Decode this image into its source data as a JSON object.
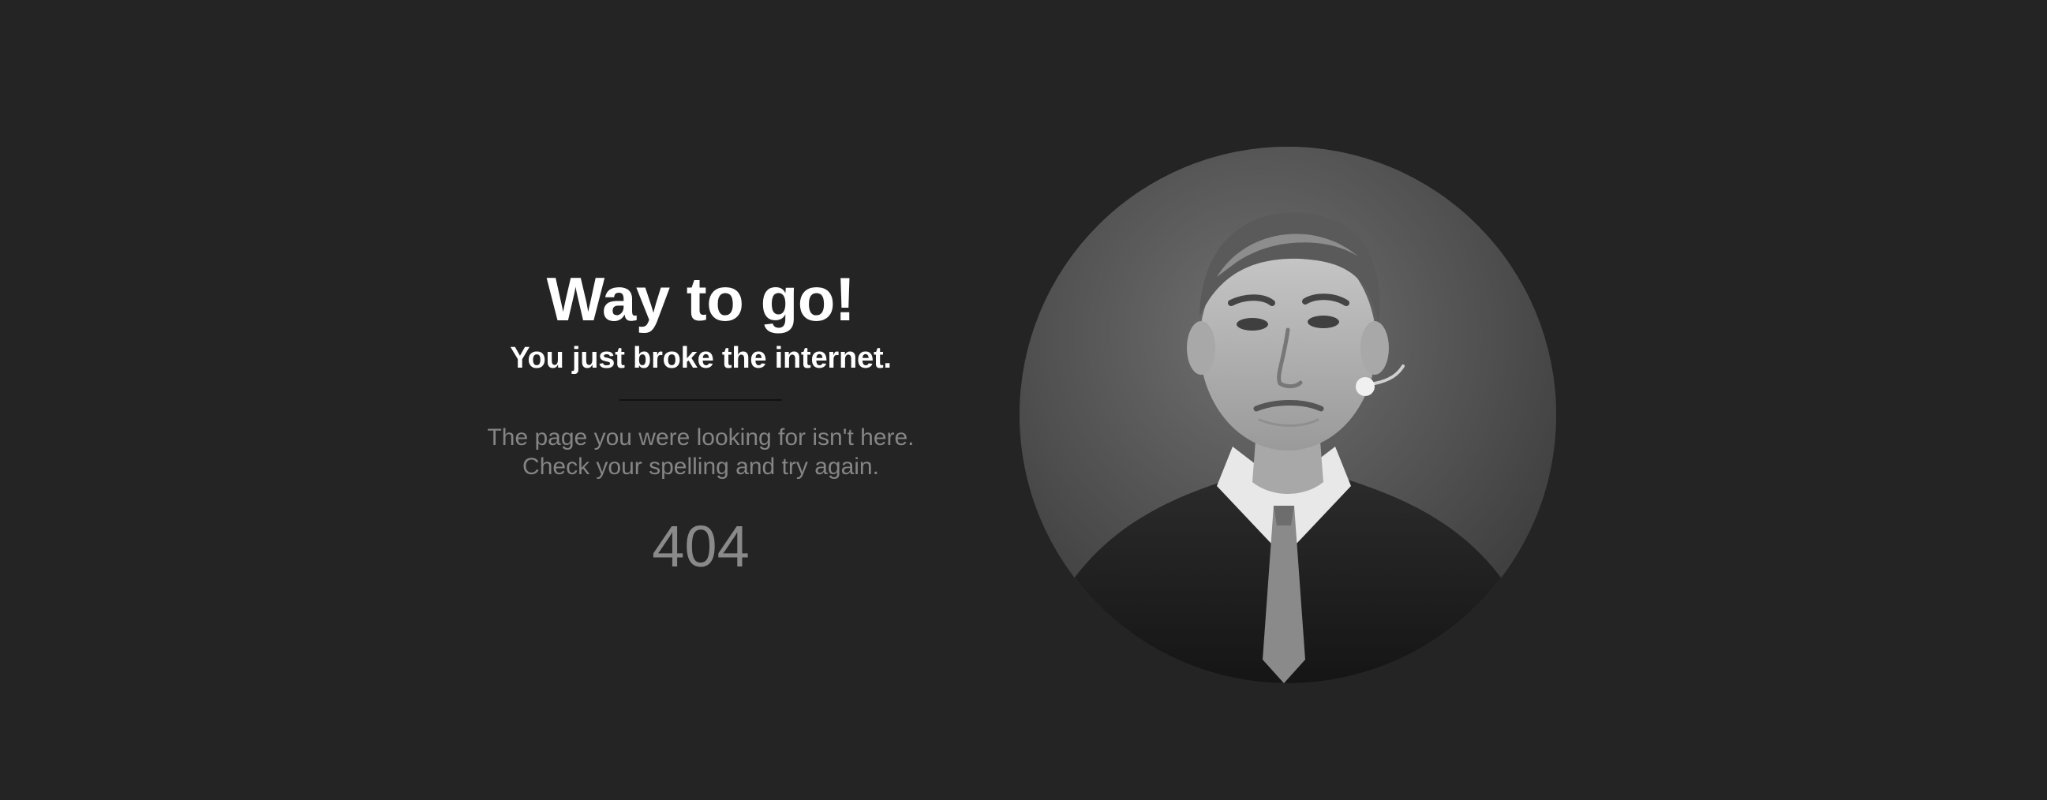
{
  "headline": "Way to go!",
  "subheadline": "You just broke the internet.",
  "message_line1": "The page you were looking for isn't here.",
  "message_line2": "Check your spelling and try again.",
  "error_code": "404",
  "colors": {
    "background": "#252425",
    "headline": "#ffffff",
    "message": "#858585",
    "divider": "#111111"
  }
}
